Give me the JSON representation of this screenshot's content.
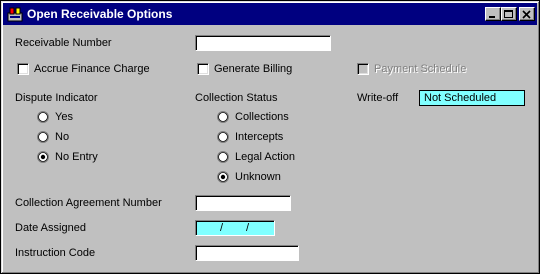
{
  "window": {
    "title": "Open Receivable Options"
  },
  "receivable_number": {
    "label": "Receivable Number",
    "value": ""
  },
  "checkboxes": {
    "accrue_finance_charge": {
      "label": "Accrue Finance Charge",
      "checked": false
    },
    "generate_billing": {
      "label": "Generate Billing",
      "checked": false
    },
    "payment_schedule": {
      "label": "Payment Schedule",
      "checked": false,
      "enabled": false
    }
  },
  "dispute_indicator": {
    "label": "Dispute Indicator",
    "options": [
      "Yes",
      "No",
      "No Entry"
    ],
    "selected": "No Entry"
  },
  "collection_status": {
    "label": "Collection Status",
    "options": [
      "Collections",
      "Intercepts",
      "Legal Action",
      "Unknown"
    ],
    "selected": "Unknown"
  },
  "write_off": {
    "label": "Write-off",
    "value": "Not Scheduled"
  },
  "collection_agreement_number": {
    "label": "Collection Agreement Number",
    "value": ""
  },
  "date_assigned": {
    "label": "Date Assigned",
    "sep1": "/",
    "sep2": "/"
  },
  "instruction_code": {
    "label": "Instruction Code",
    "value": ""
  },
  "colors": {
    "title_bar": "#000080",
    "highlight_field": "#80ffff",
    "face": "#c0c0c0"
  },
  "icons": [
    "app-icon",
    "minimize-icon",
    "maximize-icon",
    "close-icon"
  ]
}
